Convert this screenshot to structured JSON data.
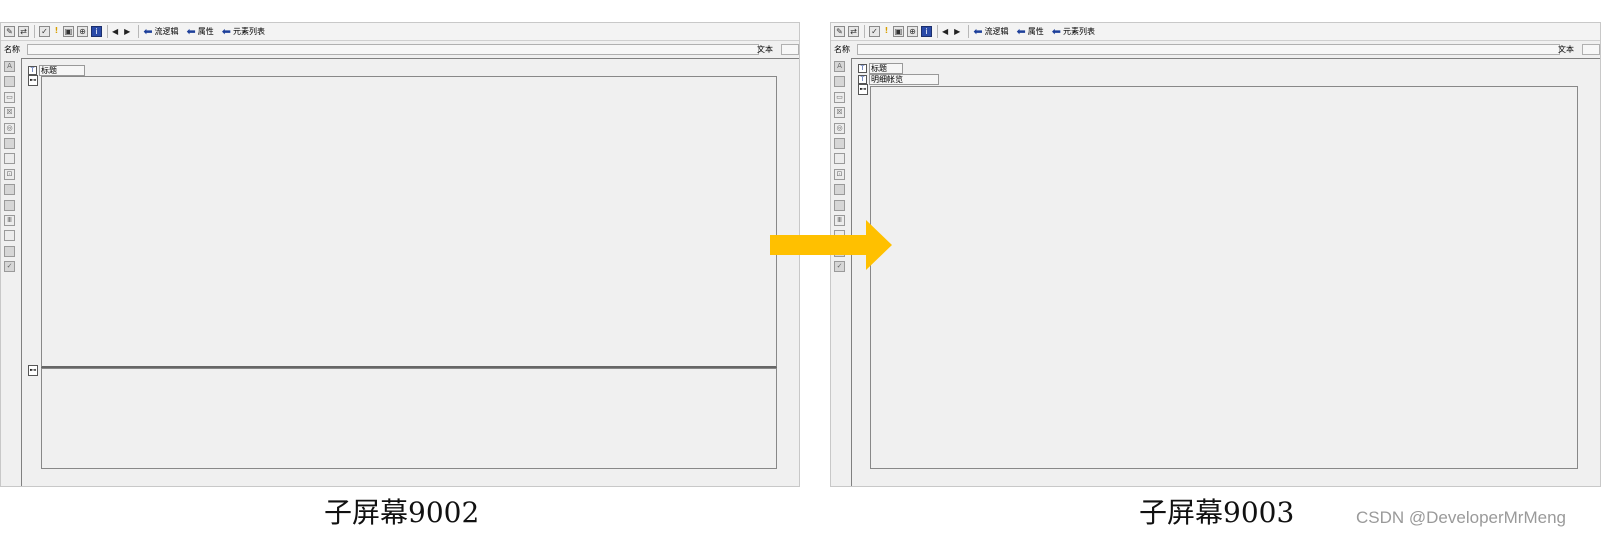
{
  "toolbar": {
    "links": [
      "流逻辑",
      "属性",
      "元素列表"
    ]
  },
  "namebar": {
    "name_label": "名称",
    "text_label": "文本"
  },
  "left_screen": {
    "elements": [
      "标题"
    ],
    "caption": "子屏幕9002"
  },
  "right_screen": {
    "elements": [
      "标题",
      "明细帐览"
    ],
    "caption": "子屏幕9003"
  },
  "transition_arrow": {
    "color": "#FFC000"
  },
  "watermark": "CSDN @DeveloperMrMeng"
}
